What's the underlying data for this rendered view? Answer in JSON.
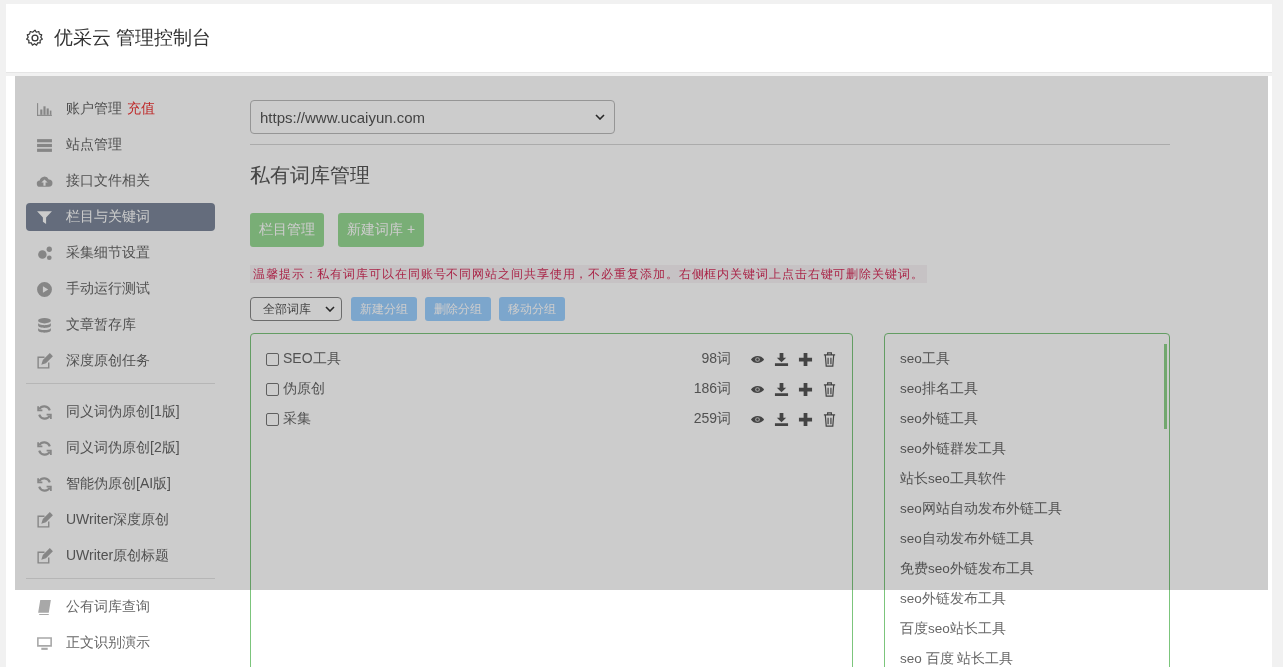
{
  "header": {
    "title": "优采云 管理控制台"
  },
  "sidebar": {
    "groups": [
      {
        "items": [
          {
            "label": "账户管理",
            "badge": "充值",
            "selected": false
          },
          {
            "label": "站点管理",
            "selected": false
          },
          {
            "label": "接口文件相关",
            "selected": false
          },
          {
            "label": "栏目与关键词",
            "selected": true
          },
          {
            "label": "采集细节设置",
            "selected": false
          },
          {
            "label": "手动运行测试",
            "selected": false
          },
          {
            "label": "文章暂存库",
            "selected": false
          },
          {
            "label": "深度原创任务",
            "selected": false
          }
        ]
      },
      {
        "items": [
          {
            "label": "同义词伪原创[1版]",
            "selected": false
          },
          {
            "label": "同义词伪原创[2版]",
            "selected": false
          },
          {
            "label": "智能伪原创[AI版]",
            "selected": false
          },
          {
            "label": "UWriter深度原创",
            "selected": false
          },
          {
            "label": "UWriter原创标题",
            "selected": false
          }
        ]
      },
      {
        "items": [
          {
            "label": "公有词库查询",
            "selected": false
          },
          {
            "label": "正文识别演示",
            "selected": false
          }
        ]
      }
    ]
  },
  "site_select": {
    "value": "https://www.ucaiyun.com"
  },
  "page_title": "私有词库管理",
  "action_buttons": [
    "栏目管理",
    "新建词库 +"
  ],
  "hint": "温馨提示：私有词库可以在同账号不同网站之间共享使用，不必重复添加。右侧框内关键词上点击右键可删除关键词。",
  "group_select": {
    "value": "全部词库"
  },
  "group_buttons": [
    "新建分组",
    "删除分组",
    "移动分组"
  ],
  "libraries": [
    {
      "name": "SEO工具",
      "count": "98词",
      "checked": false
    },
    {
      "name": "伪原创",
      "count": "186词",
      "checked": false
    },
    {
      "name": "采集",
      "count": "259词",
      "checked": false
    }
  ],
  "keywords": [
    "seo工具",
    "seo排名工具",
    "seo外链工具",
    "seo外链群发工具",
    "站长seo工具软件",
    "seo网站自动发布外链工具",
    "seo自动发布外链工具",
    "免费seo外链发布工具",
    "seo外链发布工具",
    "百度seo站长工具",
    "seo 百度 站长工具"
  ]
}
